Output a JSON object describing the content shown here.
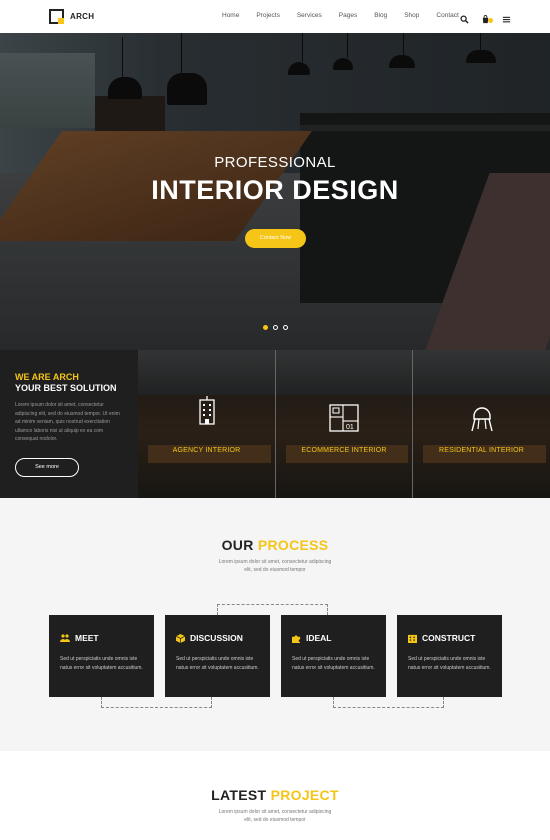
{
  "header": {
    "logo_text": "ARCH",
    "nav": [
      "Home",
      "Projects",
      "Services",
      "Pages",
      "Blog",
      "Shop",
      "Contact"
    ],
    "icons": [
      "search-icon",
      "cart-icon",
      "menu-icon"
    ]
  },
  "hero": {
    "subtitle": "PROFESSIONAL",
    "title": "INTERIOR DESIGN",
    "button": "Contact Now",
    "slides": 3,
    "active_slide": 1
  },
  "about": {
    "eyebrow": "WE ARE ARCH",
    "title": "YOUR BEST SOLUTION",
    "text": "Lorem ipsum dolor sit amet, consectetur adipiscing elit, sed do eiusmod tempor. Ut enim ad minim veniam, quis nostrud exercitation ullamco laboris nisi ut aliquip ex ea com consequat nodolor.",
    "button": "See more"
  },
  "services": [
    {
      "label": "AGENCY INTERIOR",
      "icon": "building-icon"
    },
    {
      "label": "ECOMMERCE INTERIOR",
      "icon": "floorplan-icon"
    },
    {
      "label": "RESIDENTIAL INTERIOR",
      "icon": "chair-icon"
    }
  ],
  "process": {
    "title_a": "OUR",
    "title_b": "PROCESS",
    "subtitle_1": "Lorem ipsum dolor sit amet, consectetur adipiscing",
    "subtitle_2": "elit, sed do eiusmod tempor",
    "steps": [
      {
        "title": "MEET",
        "icon": "people-icon",
        "text": "Sed ut perspiciatis unde omnis iste natus error sit voluptatem accusitium."
      },
      {
        "title": "DISCUSSION",
        "icon": "box-icon",
        "text": "Sed ut perspiciatis unde omnis iste natus error sit voluptatem accusitium."
      },
      {
        "title": "IDEAL",
        "icon": "puzzle-icon",
        "text": "Sed ut perspiciatis unde omnis iste natus error sit voluptatem accusitium."
      },
      {
        "title": "CONSTRUCT",
        "icon": "building-icon",
        "text": "Sed ut perspiciatis unde omnis iste natus error sit voluptatem accusitium."
      }
    ]
  },
  "latest": {
    "title_a": "LATEST",
    "title_b": "PROJECT",
    "subtitle_1": "Lorem ipsum dolor sit amet, consectetur adipiscing",
    "subtitle_2": "elit, sed do eiusmod tempor"
  },
  "colors": {
    "accent": "#f5c518",
    "dark": "#1f1f1f",
    "light_bg": "#f5f5f5"
  }
}
